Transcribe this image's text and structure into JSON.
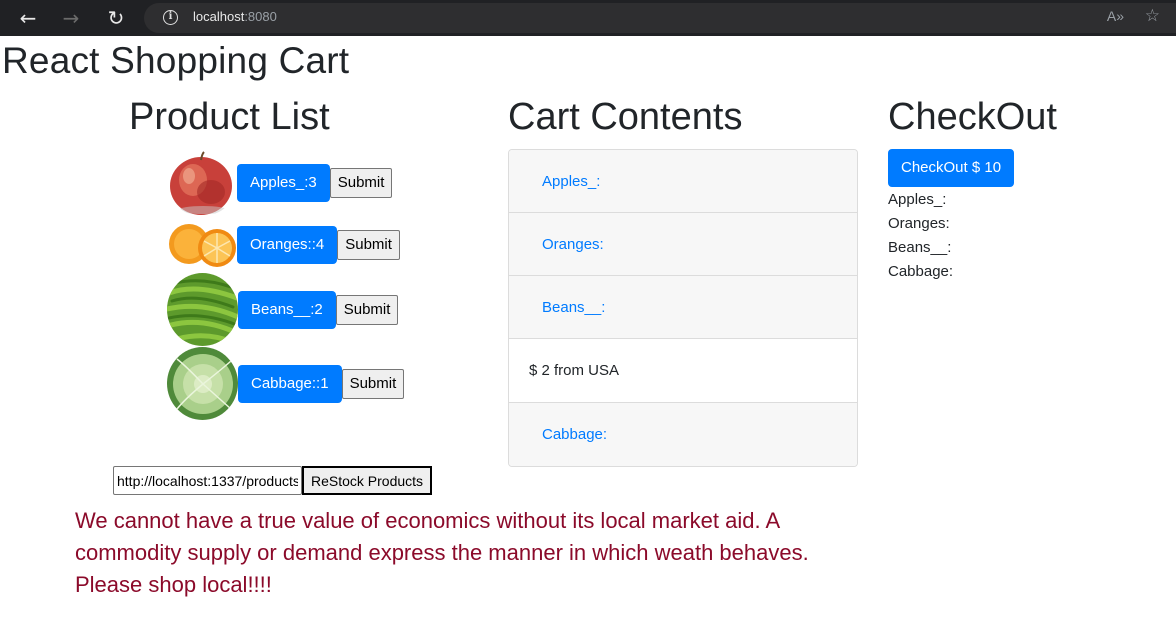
{
  "browser": {
    "url_host": "localhost",
    "url_port": ":8080",
    "read_aloud_label": "A»"
  },
  "page": {
    "title": "React Shopping Cart"
  },
  "product_list": {
    "title": "Product List",
    "submit_label": "Submit",
    "items": [
      {
        "label": "Apples_:3"
      },
      {
        "label": "Oranges::4"
      },
      {
        "label": "Beans__:2"
      },
      {
        "label": "Cabbage::1"
      }
    ]
  },
  "restock": {
    "input_value": "http://localhost:1337/products",
    "button_label": "ReStock Products"
  },
  "message": "We cannot have a true value of economics without its local market aid. A commodity supply or demand express the manner in which weath behaves. Please shop local!!!!",
  "cart": {
    "title": "Cart Contents",
    "items": [
      "Apples_:",
      "Oranges:",
      "Beans__:",
      "$ 2 from USA",
      "Cabbage:"
    ]
  },
  "checkout": {
    "title": "CheckOut",
    "button_label": "CheckOut $ 10",
    "lines": [
      "Apples_:",
      "Oranges:",
      "Beans__:",
      "Cabbage:"
    ]
  },
  "colors": {
    "primary": "#007bff",
    "message": "#8b0a2a",
    "chrome": "#202124"
  }
}
